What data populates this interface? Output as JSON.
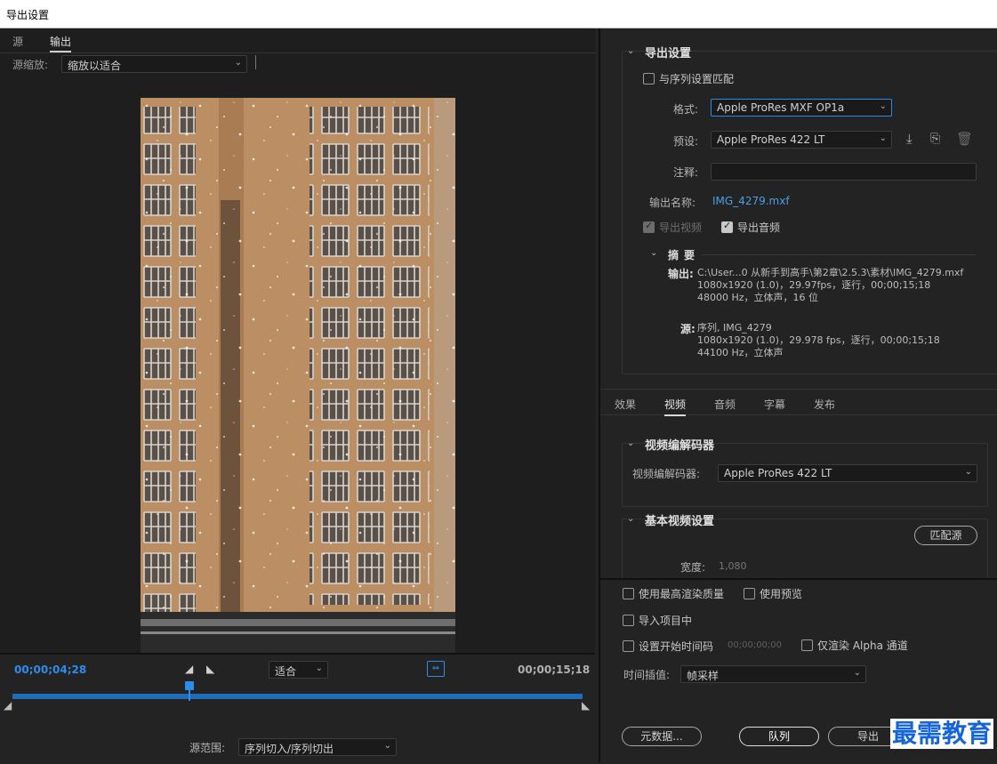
{
  "window": {
    "title": "导出设置"
  },
  "left": {
    "tabs": [
      "源",
      "输出"
    ],
    "active_tab": "输出",
    "source_scale_label": "源缩放:",
    "source_scale_value": "缩放以适合",
    "current_timecode": "00;00;04;28",
    "fit_value": "适合",
    "end_timecode": "00;00;15;18",
    "source_range_label": "源范围:",
    "source_range_value": "序列切入/序列切出",
    "playhead_fraction": 0.31
  },
  "export_settings": {
    "section_title": "导出设置",
    "match_sequence_label": "与序列设置匹配",
    "format_label": "格式:",
    "format_value": "Apple ProRes MXF OP1a",
    "preset_label": "预设:",
    "preset_value": "Apple ProRes 422 LT",
    "comments_label": "注释:",
    "comments_value": "",
    "output_name_label": "输出名称:",
    "output_name_value": "IMG_4279.mxf",
    "export_video_label": "导出视频",
    "export_audio_label": "导出音频",
    "summary_title": "摘要",
    "output_label": "输出:",
    "output_lines": [
      "C:\\User...0 从新手到高手\\第2章\\2.5.3\\素材\\IMG_4279.mxf",
      "1080x1920 (1.0)，29.97fps，逐行，00;00;15;18",
      "48000 Hz，立体声，16 位"
    ],
    "source_label": "源:",
    "source_lines": [
      "序列, IMG_4279",
      "1080x1920 (1.0)，29.978 fps，逐行，00;00;15;18",
      "44100 Hz，立体声"
    ]
  },
  "tabs": {
    "items": [
      "效果",
      "视频",
      "音频",
      "字幕",
      "发布"
    ],
    "active": "视频"
  },
  "video": {
    "codec_section": "视频编解码器",
    "codec_label": "视频编解码器:",
    "codec_value": "Apple ProRes 422 LT",
    "basic_section": "基本视频设置",
    "match_source_button": "匹配源",
    "width_label": "宽度:",
    "width_value": "1,080"
  },
  "bottom": {
    "max_render_label": "使用最高渲染质量",
    "use_previews_label": "使用预览",
    "import_project_label": "导入项目中",
    "set_start_tc_label": "设置开始时间码",
    "start_tc_value": "00;00;00;00",
    "alpha_only_label": "仅渲染 Alpha 通道",
    "time_interp_label": "时间插值:",
    "time_interp_value": "帧采样",
    "metadata_button": "元数据...",
    "queue_button": "队列",
    "export_button": "导出",
    "watermark": "最需教育"
  },
  "colors": {
    "accent_blue": "#2d8ceb",
    "link_blue": "#4a9fe8",
    "panel_bg": "#232323",
    "preview_bg": "#1e1e1e"
  }
}
